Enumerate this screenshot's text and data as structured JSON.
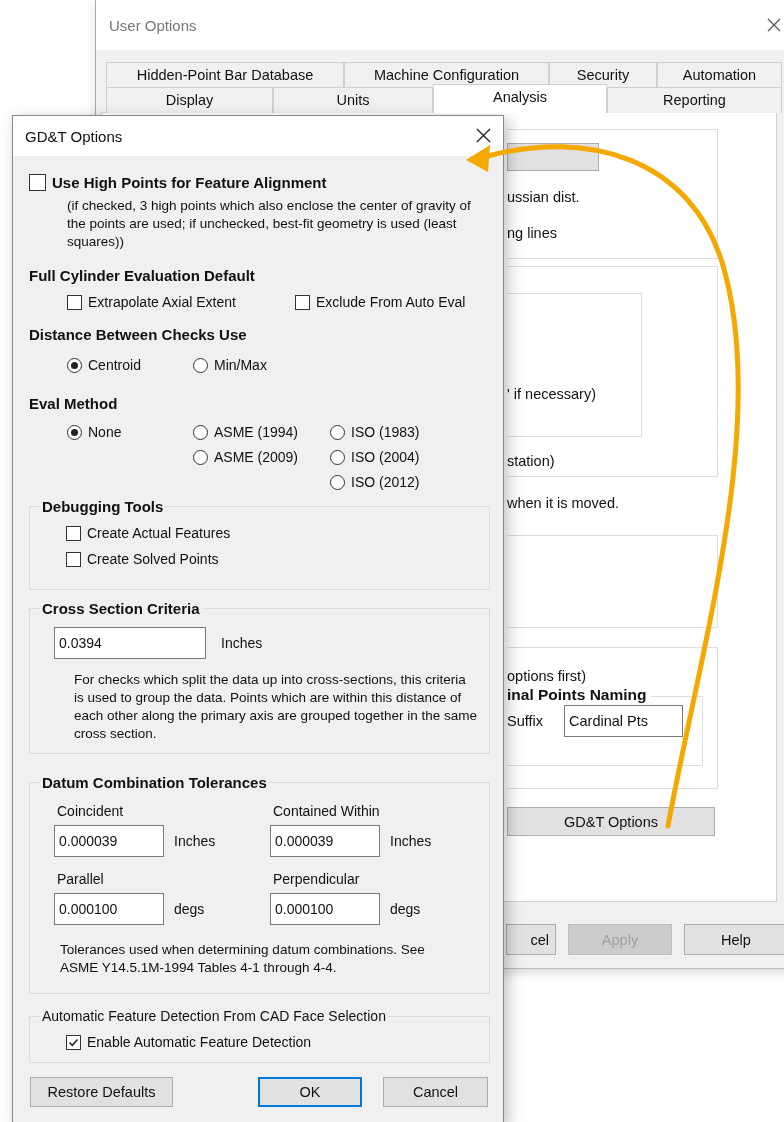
{
  "user_options": {
    "title": "User Options",
    "tab_rows": [
      [
        {
          "label": "Hidden-Point Bar Database",
          "selected": false
        },
        {
          "label": "Machine Configuration",
          "selected": false
        },
        {
          "label": "Security",
          "selected": false
        },
        {
          "label": "Automation",
          "selected": false
        }
      ],
      [
        {
          "label": "Display",
          "selected": false
        },
        {
          "label": "Units",
          "selected": false
        },
        {
          "label": "Analysis",
          "selected": true
        },
        {
          "label": "Reporting",
          "selected": false
        }
      ]
    ],
    "group_1_lines": [
      "ussian dist.",
      "ng lines"
    ],
    "inner_group_line": "' if necessary)",
    "group_2_line": "station)",
    "moved_note": "when it is moved.",
    "group_4_line": "options first)",
    "naming_group_title": "inal Points Naming",
    "suffix_label": "Suffix",
    "suffix_value": "Cardinal Pts",
    "gdt_button": "GD&T Options",
    "buttons": [
      {
        "label": "cel",
        "disabled": false
      },
      {
        "label": "Apply",
        "disabled": true
      },
      {
        "label": "Help",
        "disabled": false
      }
    ]
  },
  "gdt_dialog": {
    "title": "GD&T Options",
    "high_points": {
      "label": "Use High Points for Feature Alignment",
      "checked": false,
      "note": "(if checked, 3 high points which also enclose the center of gravity of the points are used; if unchecked, best-fit geometry is used (least squares))"
    },
    "full_cylinder": {
      "heading": "Full Cylinder Evaluation Default",
      "options": [
        {
          "label": "Extrapolate Axial Extent",
          "checked": false
        },
        {
          "label": "Exclude From Auto Eval",
          "checked": false
        }
      ]
    },
    "distance": {
      "heading": "Distance Between Checks Use",
      "options": [
        {
          "label": "Centroid",
          "selected": true
        },
        {
          "label": "Min/Max",
          "selected": false
        }
      ]
    },
    "eval_method": {
      "heading": "Eval Method",
      "columns": [
        [
          {
            "label": "None",
            "selected": true
          }
        ],
        [
          {
            "label": "ASME (1994)",
            "selected": false
          },
          {
            "label": "ASME (2009)",
            "selected": false
          }
        ],
        [
          {
            "label": "ISO (1983)",
            "selected": false
          },
          {
            "label": "ISO (2004)",
            "selected": false
          },
          {
            "label": "ISO (2012)",
            "selected": false
          }
        ]
      ]
    },
    "debugging": {
      "title": "Debugging Tools",
      "options": [
        {
          "label": "Create Actual Features",
          "checked": false
        },
        {
          "label": "Create Solved Points",
          "checked": false
        }
      ]
    },
    "cross_section": {
      "title": "Cross Section Criteria",
      "value": "0.0394",
      "unit": "Inches",
      "note": "For checks which split the data up into cross-sections, this criteria is used to group the data.  Points which are within this distance of each other along the primary axis are grouped together in the same cross section."
    },
    "datum": {
      "title": "Datum Combination Tolerances",
      "fields": [
        {
          "label": "Coincident",
          "value": "0.000039",
          "unit": "Inches"
        },
        {
          "label": "Contained Within",
          "value": "0.000039",
          "unit": "Inches"
        },
        {
          "label": "Parallel",
          "value": "0.000100",
          "unit": "degs"
        },
        {
          "label": "Perpendicular",
          "value": "0.000100",
          "unit": "degs"
        }
      ],
      "note": "Tolerances used when determining datum combinations. See ASME Y14.5.1M-1994 Tables 4-1 through 4-4."
    },
    "auto_detect": {
      "title": "Automatic Feature Detection From CAD Face Selection",
      "option": {
        "label": "Enable Automatic Feature Detection",
        "checked": true
      }
    },
    "buttons": [
      {
        "label": "Restore Defaults",
        "default": false
      },
      {
        "label": "OK",
        "default": true
      },
      {
        "label": "Cancel",
        "default": false
      }
    ]
  }
}
